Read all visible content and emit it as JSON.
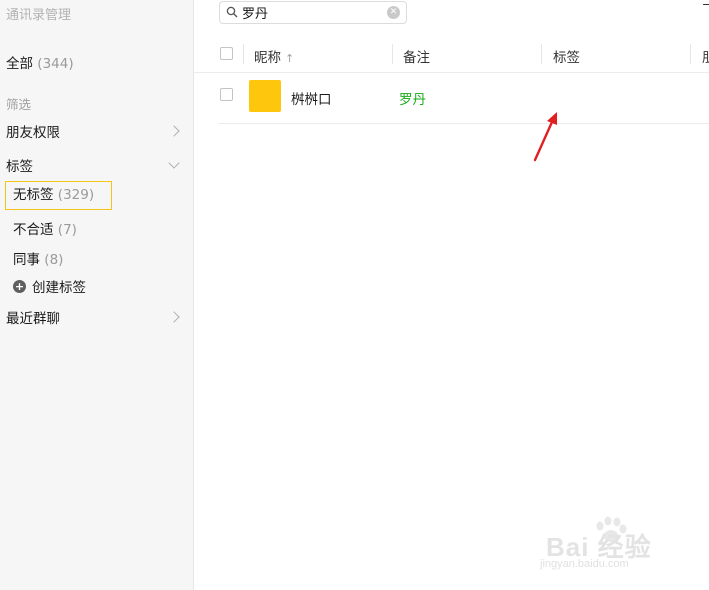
{
  "sidebar": {
    "title": "通讯录管理",
    "all_label": "全部",
    "all_count": "(344)",
    "filter_section": "筛选",
    "friend_permission": "朋友权限",
    "tags": "标签",
    "tag_items": [
      {
        "label": "无标签",
        "count": "(329)"
      },
      {
        "label": "不合适",
        "count": "(7)"
      },
      {
        "label": "同事",
        "count": "(8)"
      }
    ],
    "create_tag": "创建标签",
    "recent_groups": "最近群聊"
  },
  "search": {
    "value": "罗丹"
  },
  "table": {
    "columns": [
      "昵称",
      "备注",
      "标签",
      "朋"
    ],
    "sort_indicator": "↑",
    "rows": [
      {
        "nickname": "桝桝口",
        "remark": "罗丹",
        "tag": "",
        "avatar_color": "#fec70e"
      }
    ]
  },
  "colors": {
    "selected_border": "#f5c518",
    "remark_green": "#1aad19",
    "arrow_red": "#e02020"
  },
  "watermark": {
    "text": "Bai 经验",
    "sub": "jingyan.baidu.com"
  }
}
